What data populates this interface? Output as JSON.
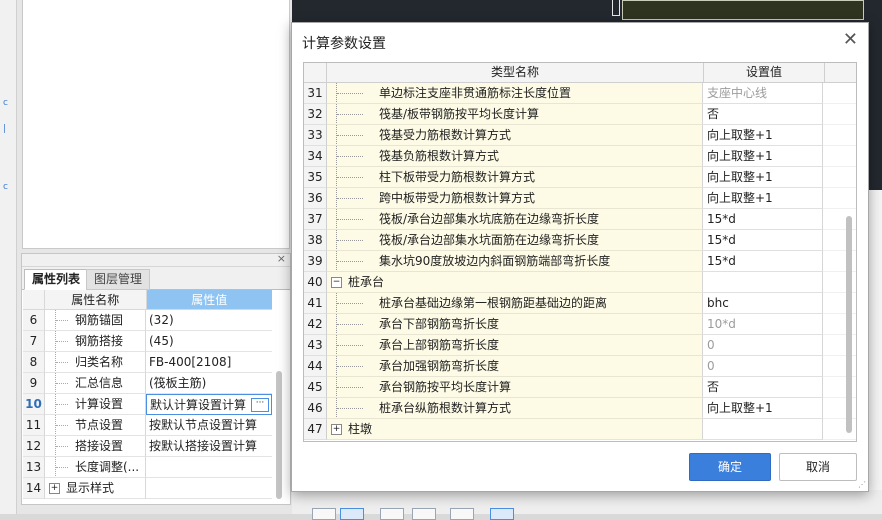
{
  "dialog": {
    "title": "计算参数设置",
    "columns": {
      "name": "类型名称",
      "value": "设置值"
    },
    "rows": [
      {
        "num": "31",
        "name": "单边标注支座非贯通筋标注长度位置",
        "value": "支座中心线",
        "muted": true
      },
      {
        "num": "32",
        "name": "筏基/板带钢筋按平均长度计算",
        "value": "否"
      },
      {
        "num": "33",
        "name": "筏基受力筋根数计算方式",
        "value": "向上取整+1"
      },
      {
        "num": "34",
        "name": "筏基负筋根数计算方式",
        "value": "向上取整+1"
      },
      {
        "num": "35",
        "name": "柱下板带受力筋根数计算方式",
        "value": "向上取整+1"
      },
      {
        "num": "36",
        "name": "跨中板带受力筋根数计算方式",
        "value": "向上取整+1"
      },
      {
        "num": "37",
        "name": "筏板/承台边部集水坑底筋在边缘弯折长度",
        "value": "15*d"
      },
      {
        "num": "38",
        "name": "筏板/承台边部集水坑面筋在边缘弯折长度",
        "value": "15*d"
      },
      {
        "num": "39",
        "name": "集水坑90度放坡边内斜面钢筋端部弯折长度",
        "value": "15*d"
      },
      {
        "num": "40",
        "name": "桩承台",
        "value": "",
        "group": true,
        "expander": "−"
      },
      {
        "num": "41",
        "name": "桩承台基础边缘第一根钢筋距基础边的距离",
        "value": "bhc"
      },
      {
        "num": "42",
        "name": "承台下部钢筋弯折长度",
        "value": "10*d",
        "muted": true
      },
      {
        "num": "43",
        "name": "承台上部钢筋弯折长度",
        "value": "0",
        "muted": true
      },
      {
        "num": "44",
        "name": "承台加强钢筋弯折长度",
        "value": "0",
        "muted": true
      },
      {
        "num": "45",
        "name": "承台钢筋按平均长度计算",
        "value": "否"
      },
      {
        "num": "46",
        "name": "桩承台纵筋根数计算方式",
        "value": "向上取整+1"
      },
      {
        "num": "47",
        "name": "柱墩",
        "value": "",
        "group": true,
        "expander": "+"
      }
    ],
    "buttons": {
      "ok": "确定",
      "cancel": "取消"
    },
    "close_icon": "close-icon"
  },
  "property_panel": {
    "tabs": [
      {
        "label": "属性列表",
        "active": true
      },
      {
        "label": "图层管理",
        "active": false
      }
    ],
    "columns": {
      "name": "属性名称",
      "value": "属性值"
    },
    "rows": [
      {
        "num": "6",
        "name": "钢筋锚固",
        "value": "(32)"
      },
      {
        "num": "7",
        "name": "钢筋搭接",
        "value": "(45)"
      },
      {
        "num": "8",
        "name": "归类名称",
        "value": "FB-400[2108]"
      },
      {
        "num": "9",
        "name": "汇总信息",
        "value": "(筏板主筋)"
      },
      {
        "num": "10",
        "name": "计算设置",
        "value": "默认计算设置计算",
        "selected": true
      },
      {
        "num": "11",
        "name": "节点设置",
        "value": "按默认节点设置计算"
      },
      {
        "num": "12",
        "name": "搭接设置",
        "value": "按默认搭接设置计算"
      },
      {
        "num": "13",
        "name": "长度调整(...",
        "value": ""
      },
      {
        "num": "14",
        "name": "显示样式",
        "value": "",
        "group": true,
        "expander": "+"
      }
    ]
  },
  "colors": {
    "accent": "#3b7fdc",
    "header_selected": "#8ec3f2",
    "row_highlight": "#fdfbe6",
    "viewport": "#23282f"
  }
}
